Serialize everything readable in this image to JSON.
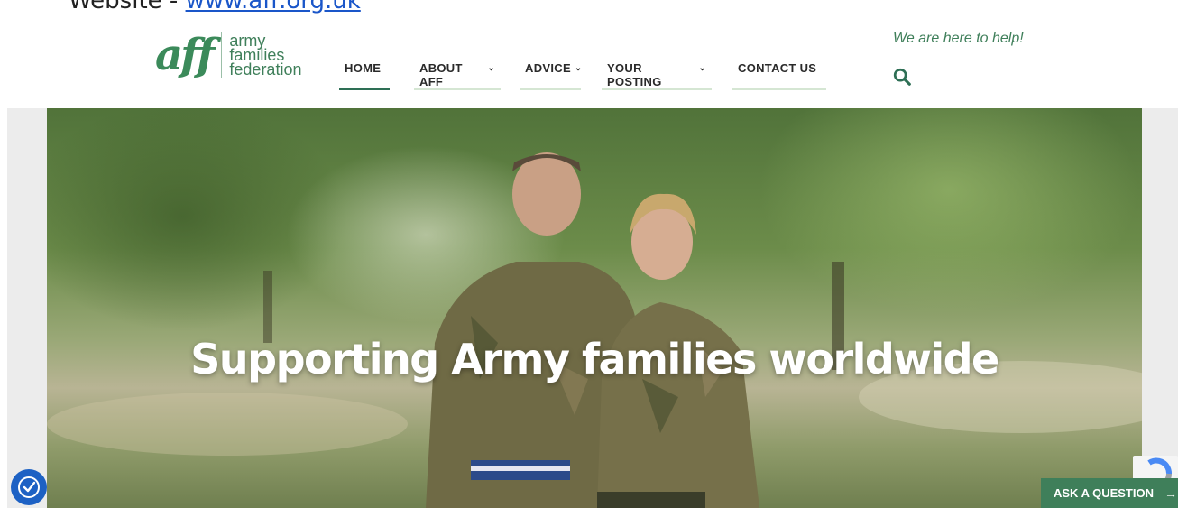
{
  "document": {
    "prefix": "Website - ",
    "link": "www.aff.org.uk"
  },
  "logo": {
    "mark": "aff",
    "lines": [
      "army",
      "families",
      "federation"
    ]
  },
  "nav": {
    "items": [
      {
        "label": "HOME",
        "active": true,
        "dropdown": false
      },
      {
        "label": "ABOUT AFF",
        "active": false,
        "dropdown": true
      },
      {
        "label": "ADVICE",
        "active": false,
        "dropdown": true
      },
      {
        "label": "YOUR POSTING",
        "active": false,
        "dropdown": true
      },
      {
        "label": "CONTACT US",
        "active": false,
        "dropdown": false
      }
    ],
    "chevron": "⌄"
  },
  "header": {
    "help_text": "We are here to help!",
    "search_icon": "search-icon"
  },
  "hero": {
    "headline": "Supporting Army families worldwide"
  },
  "widgets": {
    "ask_label": "ASK A QUESTION",
    "ask_arrow": "→",
    "accessibility_icon": "accessibility-icon",
    "recaptcha_icon": "recaptcha-icon"
  },
  "colors": {
    "brand_green": "#3f7f5a",
    "active_underline": "#2e6f55",
    "inactive_underline": "#d5e6d3",
    "accessibility_blue": "#1d61c4",
    "link_blue": "#1a56c9"
  }
}
